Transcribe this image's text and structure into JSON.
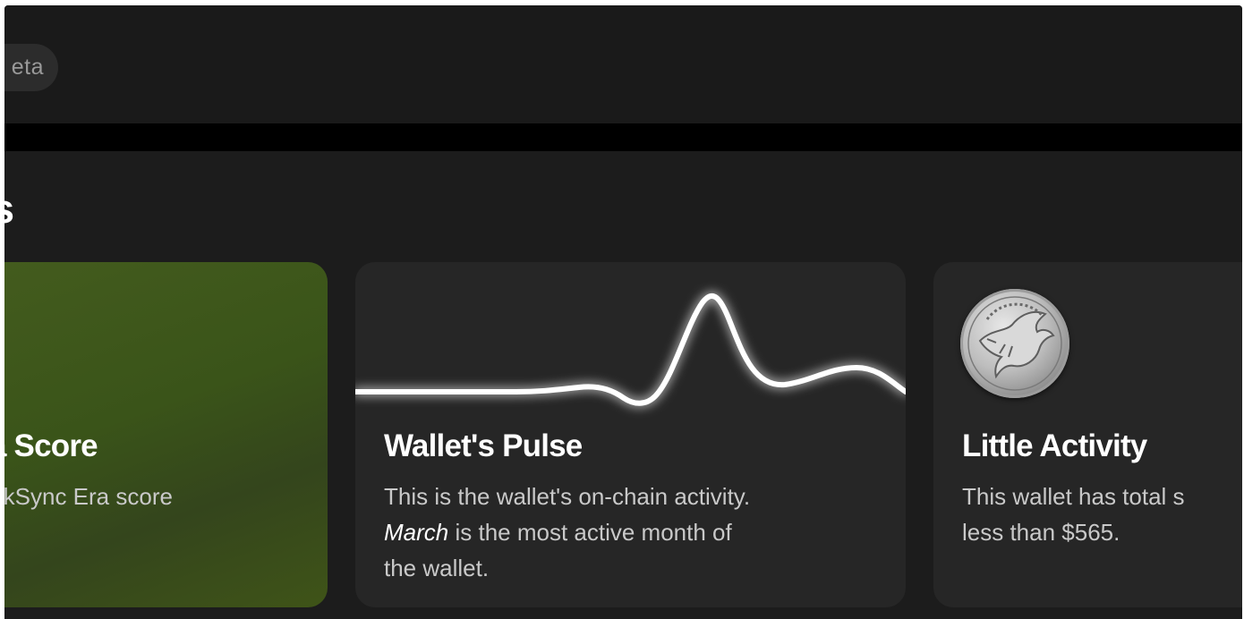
{
  "header": {
    "beta_badge": "eta"
  },
  "section": {
    "title": "s"
  },
  "cards": {
    "score": {
      "title": "c Era Score",
      "description": "mis zkSync Era score"
    },
    "pulse": {
      "title": "Wallet's Pulse",
      "line1": "This is the wallet's on-chain activity.",
      "month": "March",
      "line2_rest": " is the most active month of",
      "line3": "the wallet."
    },
    "activity": {
      "title": "Little Activity",
      "line1": "This wallet has total s",
      "line2": "less than $565.",
      "icon": "coin-icon"
    }
  },
  "colors": {
    "background": "#1c1c1c",
    "card": "#262626",
    "score_card": "#3f5419",
    "text_primary": "#ffffff",
    "text_secondary": "#c9c9c9"
  }
}
